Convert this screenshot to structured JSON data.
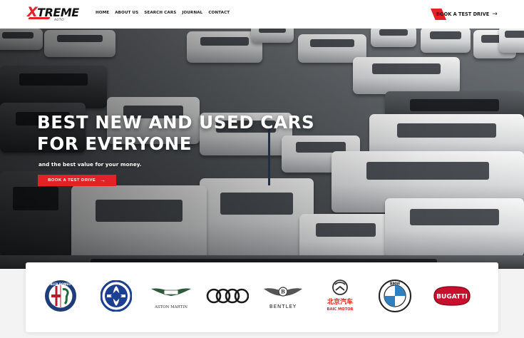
{
  "header": {
    "logo_text": "XTREME",
    "logo_sub": "AUTO",
    "nav": [
      "HOME",
      "ABOUT US",
      "SEARCH CARS",
      "JOURNAL",
      "CONTACT"
    ],
    "cta_label": "BOOK A TEST DRIVE",
    "cta_arrow": "→"
  },
  "hero": {
    "title": "BEST NEW AND USED CARS\nFOR EVERYONE",
    "subtitle": "and the best value for your money.",
    "button_label": "BOOK A TEST DRIVE",
    "button_arrow": "→"
  },
  "brands": {
    "items": [
      {
        "name": "alfa-romeo",
        "label": "ALFA ROMEO"
      },
      {
        "name": "leyland",
        "label": ""
      },
      {
        "name": "aston-martin",
        "label": "ASTON MARTIN"
      },
      {
        "name": "audi",
        "label": ""
      },
      {
        "name": "bentley",
        "label": "BENTLEY"
      },
      {
        "name": "baic",
        "label": "北京汽车",
        "label2": "BAIC MOTOR"
      },
      {
        "name": "bmw",
        "label": "BMW"
      },
      {
        "name": "bugatti",
        "label": "BUGATTI"
      }
    ]
  },
  "colors": {
    "accent": "#e32227",
    "header_bg": "#ffffff",
    "text_dark": "#1a1a1a"
  }
}
